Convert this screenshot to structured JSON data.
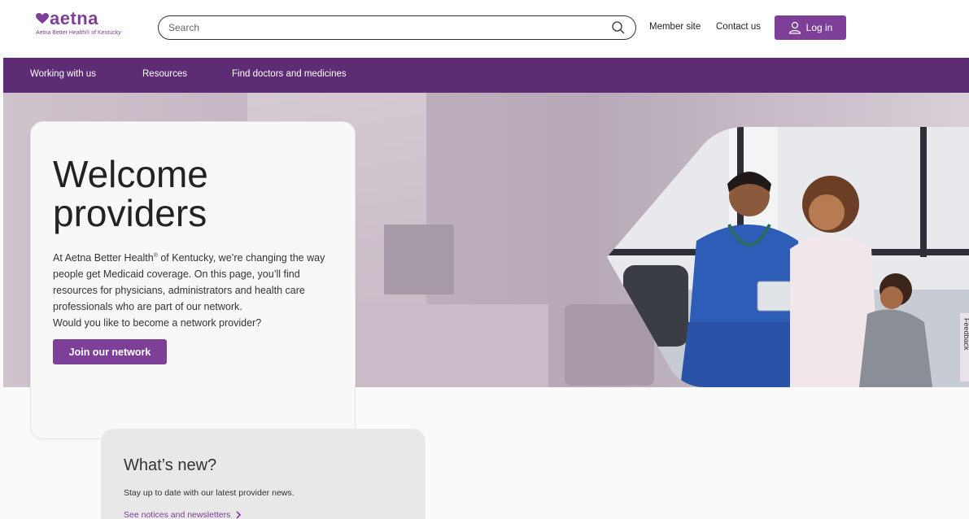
{
  "header": {
    "logo_text": "aetna",
    "logo_subtitle": "Aetna Better Health® of Kentucky",
    "search_placeholder": "Search",
    "member_site": "Member site",
    "contact_us": "Contact us",
    "login": "Log in"
  },
  "nav": {
    "items": [
      {
        "label": "Working with us"
      },
      {
        "label": "Resources"
      },
      {
        "label": "Find doctors and medicines"
      }
    ]
  },
  "hero": {
    "title_line1": "Welcome",
    "title_line2": "providers",
    "body_before_sup": "At Aetna Better Health",
    "body_sup": "®",
    "body_after_sup": " of Kentucky, we’re changing the way people get Medicaid coverage. On this page, you’ll find resources for physicians, administrators and health care professionals who are part of our network.",
    "question": "Would you like to become a network provider?",
    "cta": "Join our network",
    "feedback_tab": "Feedback"
  },
  "news": {
    "title": "What’s new?",
    "text": "Stay up to date with our latest provider news.",
    "link": "See notices and newsletters"
  },
  "colors": {
    "brand_purple": "#7d3f98",
    "nav_purple": "#5d2c75"
  },
  "icons": [
    "heart-logo-icon",
    "search-icon",
    "user-icon",
    "chevron-right-icon"
  ]
}
